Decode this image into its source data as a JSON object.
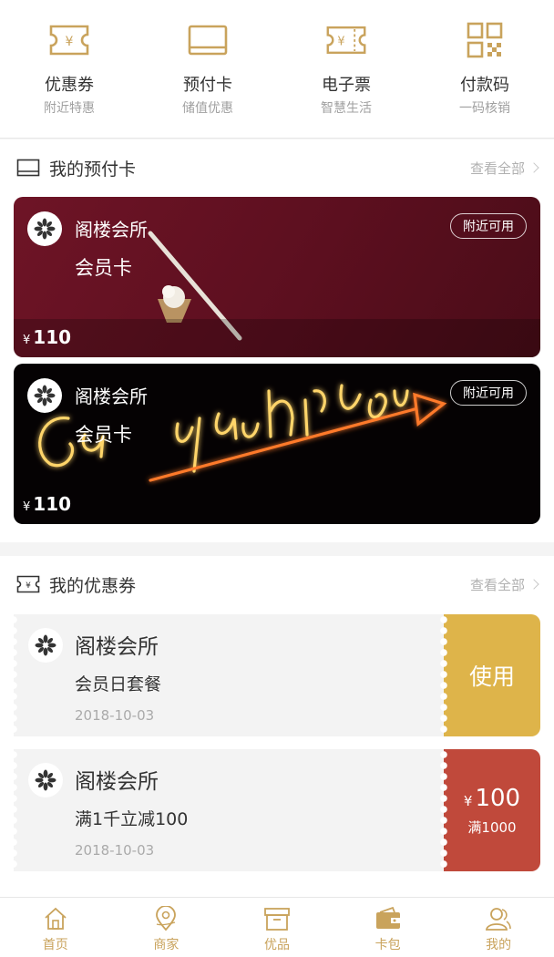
{
  "colors": {
    "gold": "#c9a35c",
    "coupon_use": "#deb44a",
    "coupon_value": "#c0493b",
    "card1": "#6e1426",
    "card2": "#050203"
  },
  "quick_menu": [
    {
      "title": "优惠券",
      "sub": "附近特惠",
      "icon": "coupon-ticket-icon"
    },
    {
      "title": "预付卡",
      "sub": "储值优惠",
      "icon": "prepaid-card-icon"
    },
    {
      "title": "电子票",
      "sub": "智慧生活",
      "icon": "e-ticket-icon"
    },
    {
      "title": "付款码",
      "sub": "一码核销",
      "icon": "qr-code-icon"
    }
  ],
  "prepaid_section": {
    "title": "我的预付卡",
    "more": "查看全部"
  },
  "prepaid_cards": [
    {
      "merchant": "阁楼会所",
      "type": "会员卡",
      "badge": "附近可用",
      "currency": "¥",
      "amount": "110"
    },
    {
      "merchant": "阁楼会所",
      "type": "会员卡",
      "badge": "附近可用",
      "currency": "¥",
      "amount": "110"
    }
  ],
  "coupon_section": {
    "title": "我的优惠券",
    "more": "查看全部"
  },
  "coupons": [
    {
      "merchant": "阁楼会所",
      "desc": "会员日套餐",
      "date": "2018-10-03",
      "action": "使用"
    },
    {
      "merchant": "阁楼会所",
      "desc": "满1千立减100",
      "date": "2018-10-03",
      "currency": "¥",
      "value": "100",
      "condition": "满1000"
    }
  ],
  "tabs": [
    {
      "label": "首页",
      "icon": "home-icon"
    },
    {
      "label": "商家",
      "icon": "merchant-location-icon"
    },
    {
      "label": "优品",
      "icon": "shop-box-icon"
    },
    {
      "label": "卡包",
      "icon": "wallet-icon"
    },
    {
      "label": "我的",
      "icon": "profile-icon"
    }
  ]
}
